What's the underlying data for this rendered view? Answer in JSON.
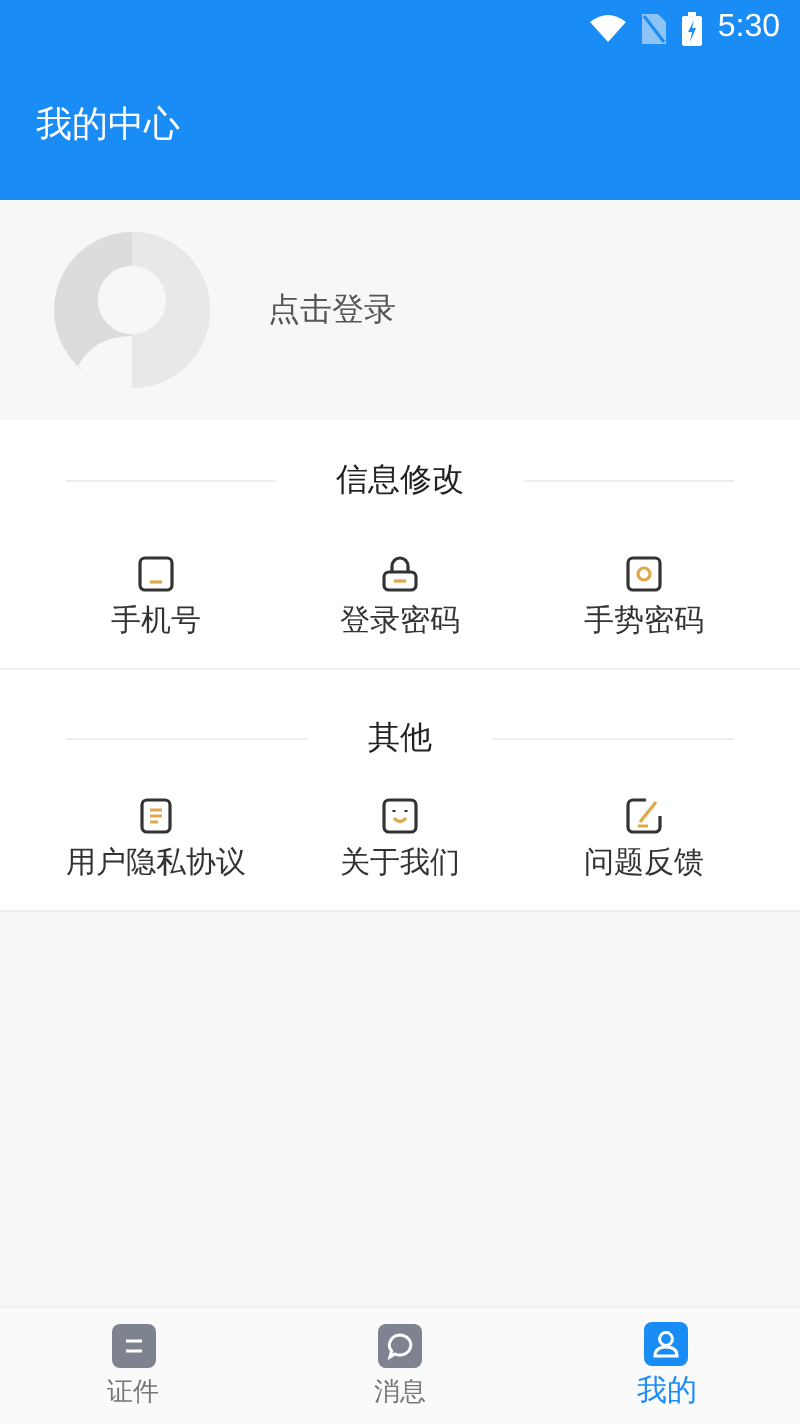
{
  "status_bar": {
    "time": "5:30"
  },
  "app_bar": {
    "title": "我的中心"
  },
  "profile": {
    "login_text": "点击登录"
  },
  "sections": [
    {
      "title": "信息修改",
      "items": [
        {
          "label": "手机号",
          "kind": "phone"
        },
        {
          "label": "登录密码",
          "kind": "lock"
        },
        {
          "label": "手势密码",
          "kind": "gesture"
        }
      ]
    },
    {
      "title": "其他",
      "items": [
        {
          "label": "用户隐私协议",
          "kind": "document"
        },
        {
          "label": "关于我们",
          "kind": "smile"
        },
        {
          "label": "问题反馈",
          "kind": "edit"
        }
      ]
    }
  ],
  "tabs": [
    {
      "label": "证件",
      "kind": "card",
      "selected": false
    },
    {
      "label": "消息",
      "kind": "chat",
      "selected": false
    },
    {
      "label": "我的",
      "kind": "user",
      "selected": true
    }
  ]
}
